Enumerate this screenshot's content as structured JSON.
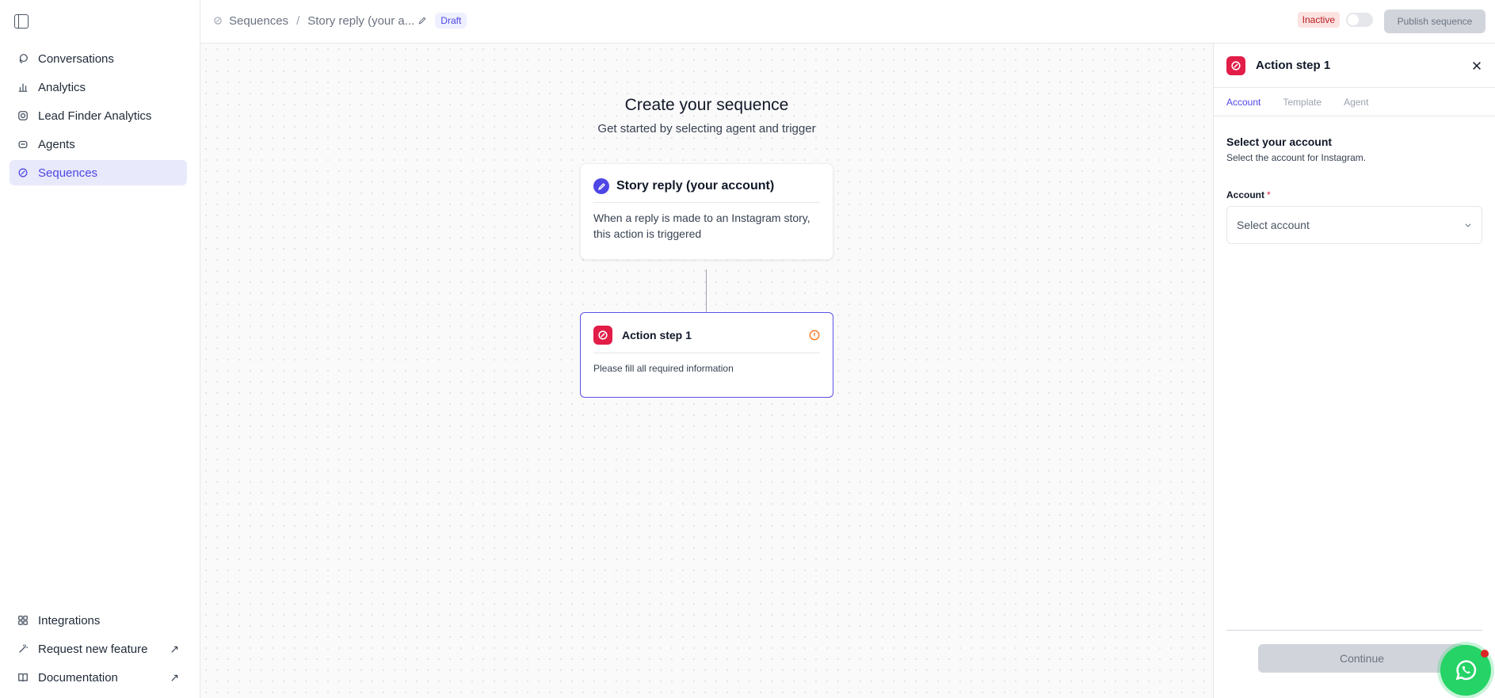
{
  "sidebar": {
    "items": [
      {
        "label": "Conversations",
        "icon": "chat-icon"
      },
      {
        "label": "Analytics",
        "icon": "bar-chart-icon"
      },
      {
        "label": "Lead Finder Analytics",
        "icon": "instagram-icon"
      },
      {
        "label": "Agents",
        "icon": "agent-icon"
      },
      {
        "label": "Sequences",
        "icon": "sequence-icon",
        "active": true
      }
    ],
    "bottom_items": [
      {
        "label": "Integrations",
        "icon": "grid-icon"
      },
      {
        "label": "Request new feature",
        "icon": "wand-icon",
        "external": "↗"
      },
      {
        "label": "Documentation",
        "icon": "book-icon",
        "external": "↗"
      }
    ]
  },
  "header": {
    "breadcrumb_root": "Sequences",
    "breadcrumb_separator": "/",
    "breadcrumb_current": "Story reply (your a...",
    "status_badge": "Draft",
    "active_state": "Inactive",
    "publish_label": "Publish sequence"
  },
  "canvas": {
    "title": "Create your sequence",
    "subtitle": "Get started by selecting agent and trigger",
    "trigger_card": {
      "title": "Story reply (your account)",
      "description": "When a reply is made to an Instagram story, this action is triggered"
    },
    "action_card": {
      "title": "Action step 1",
      "description": "Please fill all required information"
    }
  },
  "panel": {
    "title": "Action step 1",
    "tabs": [
      {
        "label": "Account",
        "active": true
      },
      {
        "label": "Template"
      },
      {
        "label": "Agent"
      }
    ],
    "section_title": "Select your account",
    "section_subtitle": "Select the account for Instagram.",
    "field_label": "Account",
    "required_mark": "*",
    "select_placeholder": "Select account",
    "continue_label": "Continue"
  },
  "colors": {
    "accent": "#4f46e5",
    "app_brand": "#e11d48",
    "whatsapp": "#25d366"
  }
}
